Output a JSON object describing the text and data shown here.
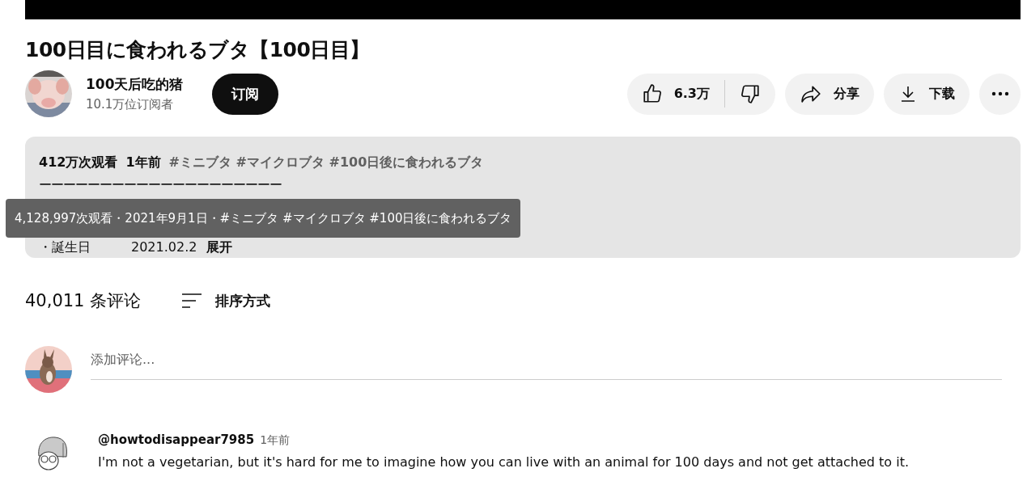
{
  "video": {
    "title": "100日目に食われるブタ【100日目】"
  },
  "channel": {
    "name": "100天后吃的猪",
    "subscribers": "10.1万位订阅者",
    "subscribe_button": "订阅"
  },
  "actions": {
    "likes": "6.3万",
    "share": "分享",
    "download": "下载"
  },
  "description": {
    "views": "412万次观看",
    "age": "1年前",
    "hashtags": "#ミニブタ #マイクロブタ #100日後に食われるブタ",
    "divider_line": "ーーーーーーーーーーーーーーーーーーーー",
    "birthday_label": "・誕生日",
    "birthday_value": "2021.02.2",
    "expand": "展开"
  },
  "tooltip": {
    "text": "4,128,997次观看・2021年9月1日・#ミニブタ #マイクロブタ #100日後に食われるブタ"
  },
  "comments": {
    "count": "40,011 条评论",
    "sort": "排序方式",
    "add_placeholder": "添加评论...",
    "items": [
      {
        "author": "@howtodisappear7985",
        "time": "1年前",
        "text": "I'm not a vegetarian, but it's hard for me to imagine how you can live with an animal for 100 days and not get attached to it."
      }
    ]
  }
}
